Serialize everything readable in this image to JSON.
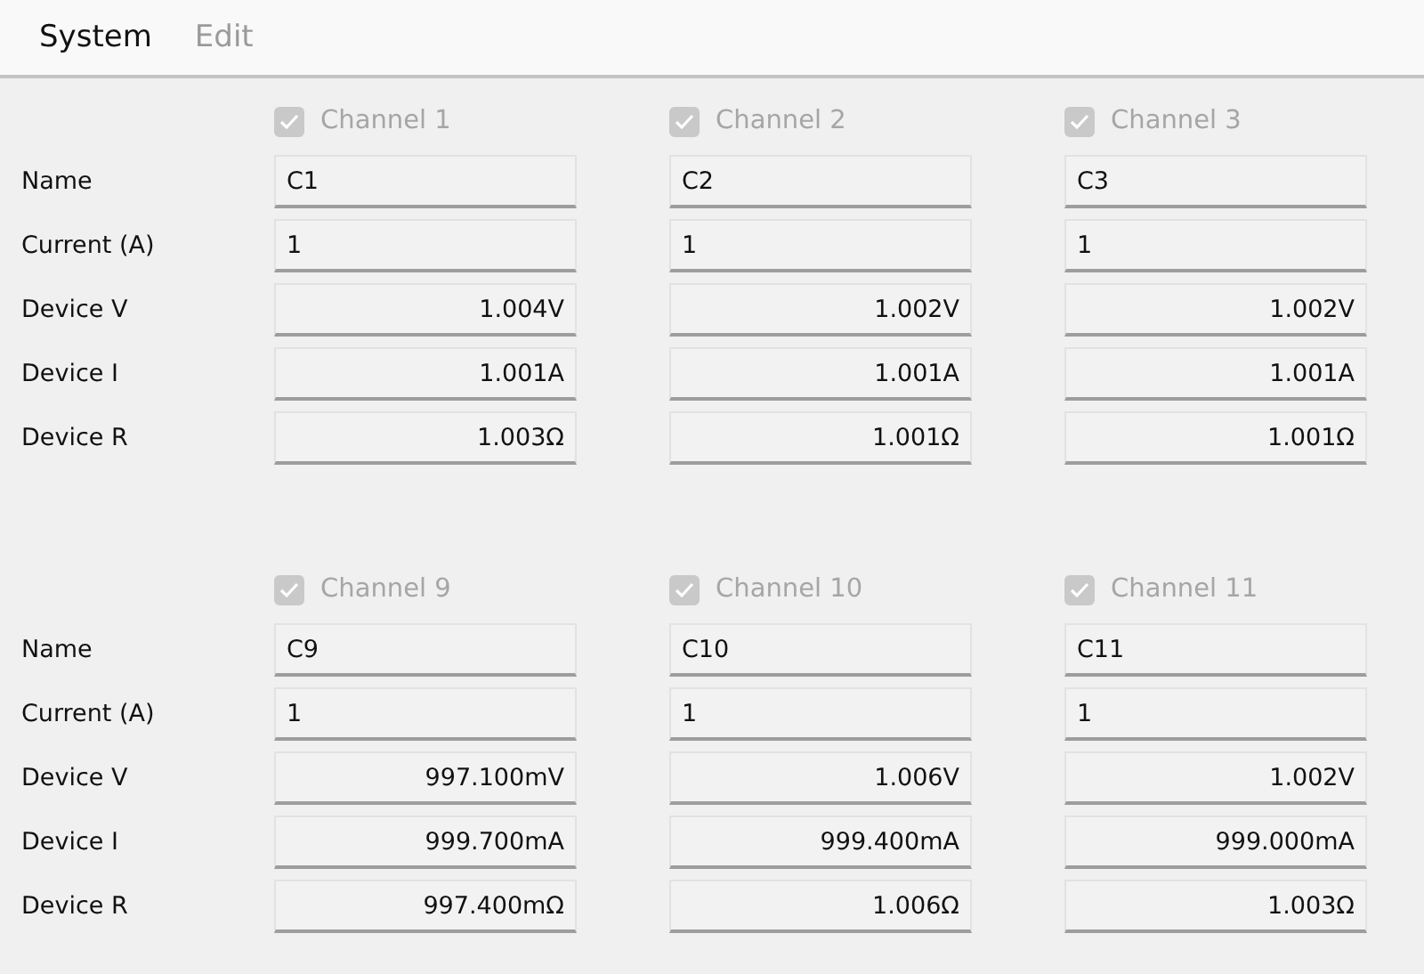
{
  "menu": [
    {
      "label": "System",
      "disabled": false
    },
    {
      "label": "Edit",
      "disabled": true
    }
  ],
  "groups": [
    {
      "rows": [
        {
          "label": "Name",
          "kind": "input"
        },
        {
          "label": "Current (A)",
          "kind": "input"
        },
        {
          "label": "Device V",
          "kind": "reading"
        },
        {
          "label": "Device I",
          "kind": "reading"
        },
        {
          "label": "Device R",
          "kind": "reading"
        }
      ],
      "channels": [
        {
          "title": "Channel 1",
          "checked": true,
          "disabled": true,
          "values": [
            "C1",
            "1",
            "1.004V",
            "1.001A",
            "1.003Ω"
          ]
        },
        {
          "title": "Channel 2",
          "checked": true,
          "disabled": true,
          "values": [
            "C2",
            "1",
            "1.002V",
            "1.001A",
            "1.001Ω"
          ]
        },
        {
          "title": "Channel 3",
          "checked": true,
          "disabled": true,
          "values": [
            "C3",
            "1",
            "1.002V",
            "1.001A",
            "1.001Ω"
          ]
        }
      ]
    },
    {
      "rows": [
        {
          "label": "Name",
          "kind": "input"
        },
        {
          "label": "Current (A)",
          "kind": "input"
        },
        {
          "label": "Device V",
          "kind": "reading"
        },
        {
          "label": "Device I",
          "kind": "reading"
        },
        {
          "label": "Device R",
          "kind": "reading"
        }
      ],
      "channels": [
        {
          "title": "Channel 9",
          "checked": true,
          "disabled": true,
          "values": [
            "C9",
            "1",
            "997.100mV",
            "999.700mA",
            "997.400mΩ"
          ]
        },
        {
          "title": "Channel 10",
          "checked": true,
          "disabled": true,
          "values": [
            "C10",
            "1",
            "1.006V",
            "999.400mA",
            "1.006Ω"
          ]
        },
        {
          "title": "Channel 11",
          "checked": true,
          "disabled": true,
          "values": [
            "C11",
            "1",
            "1.002V",
            "999.000mA",
            "1.003Ω"
          ]
        }
      ]
    }
  ]
}
